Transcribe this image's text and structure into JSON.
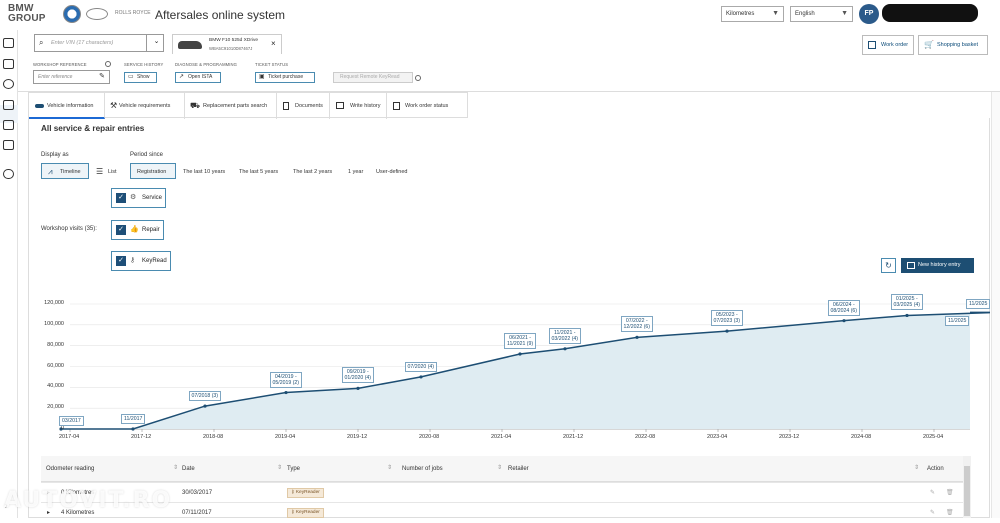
{
  "header": {
    "logo": "BMW\nGROUP",
    "brand_text": "ROLLS ROYCE",
    "title": "Aftersales online system",
    "unit_select": "Kilometres",
    "language_select": "English",
    "avatar_initials": "FP"
  },
  "vehicle_bar": {
    "vin_placeholder": "Enter VIN (17 characters)",
    "vehicle_name": "BMW F10 525d XDrive",
    "vehicle_vin": "WBA5C91010D87467J",
    "workshop_reference_label": "WORKSHOP REFERENCE",
    "workshop_reference_placeholder": "Enter reference",
    "service_history_label": "SERVICE HISTORY",
    "show_button": "Show",
    "diagnose_label": "DIAGNOSE & PROGRAMMING",
    "open_ista_button": "Open ISTA",
    "ticket_status_label": "TICKET STATUS",
    "ticket_purchase_button": "Ticket purchase",
    "remote_keyread_button": "Request Remote KeyRead",
    "work_order_button": "Work order",
    "shopping_basket_button": "Shopping basket"
  },
  "tabs": [
    {
      "label": "Vehicle information",
      "active": true
    },
    {
      "label": "Vehicle requirements"
    },
    {
      "label": "Replacement parts search"
    },
    {
      "label": "Documents"
    },
    {
      "label": "Write history"
    },
    {
      "label": "Work order status"
    }
  ],
  "main": {
    "title": "All service & repair entries",
    "display_as_label": "Display as",
    "display_timeline": "Timeline",
    "display_list": "List",
    "period_label": "Period since",
    "periods": [
      "Registration",
      "The last 10 years",
      "The last 5 years",
      "The last 2 years",
      "1 year",
      "User-defined"
    ],
    "workshop_visits_label": "Workshop visits (35):",
    "filters": [
      "Service",
      "Repair",
      "KeyRead"
    ],
    "new_history_button": "New history entry"
  },
  "chart_data": {
    "type": "area",
    "y_ticks": [
      "120,000",
      "100,000",
      "80,000",
      "60,000",
      "40,000",
      "20,000",
      "0"
    ],
    "x_ticks": [
      "2017-04",
      "2017-12",
      "2018-08",
      "2019-04",
      "2019-12",
      "2020-08",
      "2021-04",
      "2021-12",
      "2022-08",
      "2023-04",
      "2023-12",
      "2024-08",
      "2025-04"
    ],
    "ylim": [
      0,
      120000
    ],
    "series": [
      {
        "values": [
          {
            "x": "2017-03",
            "y": 0
          },
          {
            "x": "2017-11",
            "y": 4
          },
          {
            "x": "2018-07",
            "y": 22000
          },
          {
            "x": "2019-04",
            "y": 35000
          },
          {
            "x": "2019-12",
            "y": 39000
          },
          {
            "x": "2020-07",
            "y": 50000
          },
          {
            "x": "2021-06",
            "y": 72000
          },
          {
            "x": "2021-11",
            "y": 77000
          },
          {
            "x": "2022-07",
            "y": 88000
          },
          {
            "x": "2023-05",
            "y": 94000
          },
          {
            "x": "2024-06",
            "y": 104000
          },
          {
            "x": "2025-01",
            "y": 109000
          },
          {
            "x": "2025-11",
            "y": 112000
          }
        ]
      }
    ],
    "point_labels": [
      "03/2017",
      "11/2017",
      "07/2018 (3)",
      "04/2019 - 05/2019 (2)",
      "09/2019 - 01/2020 (4)",
      "07/2020 (4)",
      "06/2021 - 11/2021 (9)",
      "11/2021 - 03/2022 (4)",
      "07/2022 - 12/2022 (6)",
      "05/2023 - 07/2023 (3)",
      "06/2024 - 08/2024 (6)",
      "01/2025 - 03/2025 (4)",
      "11/2025",
      "11/2025"
    ]
  },
  "table": {
    "headers": [
      "Odometer reading",
      "Date",
      "Type",
      "Number of jobs",
      "Retailer",
      "Action"
    ],
    "rows": [
      {
        "odometer": "0 Kilometres",
        "date": "30/03/2017",
        "type": "KeyReader"
      },
      {
        "odometer": "4 Kilometres",
        "date": "07/11/2017",
        "type": "KeyReader"
      }
    ]
  },
  "watermark": "AUTOVIT.RO"
}
